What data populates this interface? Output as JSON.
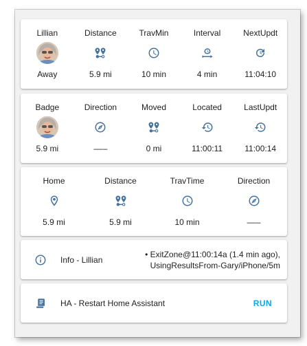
{
  "card1": {
    "columns": [
      {
        "header": "Lillian",
        "icon": "person-avatar",
        "value": "Away"
      },
      {
        "header": "Distance",
        "icon": "map-marker-distance-icon",
        "value": "5.9 mi"
      },
      {
        "header": "TravMin",
        "icon": "clock-outline-icon",
        "value": "10 min"
      },
      {
        "header": "Interval",
        "icon": "timer-sand-interval-icon",
        "value": "4 min"
      },
      {
        "header": "NextUpdt",
        "icon": "restart-clock-icon",
        "value": "11:04:10"
      }
    ]
  },
  "card2": {
    "columns": [
      {
        "header": "Badge",
        "icon": "person-avatar",
        "value": "5.9 mi"
      },
      {
        "header": "Direction",
        "icon": "compass-icon",
        "value": "–––"
      },
      {
        "header": "Moved",
        "icon": "map-marker-distance-icon",
        "value": "0 mi"
      },
      {
        "header": "Located",
        "icon": "history-clock-icon",
        "value": "11:00:11"
      },
      {
        "header": "LastUpdt",
        "icon": "history-clock-icon",
        "value": "11:00:14"
      }
    ]
  },
  "card3": {
    "columns": [
      {
        "header": "Home",
        "icon": "map-marker-outline-icon",
        "value": "5.9 mi"
      },
      {
        "header": "Distance",
        "icon": "map-marker-distance-icon",
        "value": "5.9 mi"
      },
      {
        "header": "TravTime",
        "icon": "clock-outline-icon",
        "value": "10 min"
      },
      {
        "header": "Direction",
        "icon": "compass-icon",
        "value": "–––"
      }
    ]
  },
  "info": {
    "icon": "information-outline-icon",
    "label": "Info - Lillian",
    "line1": "• ExitZone@11:00:14a (1.4 min ago),",
    "line2": "UsingResultsFrom-Gary/iPhone/5m"
  },
  "restart": {
    "icon": "script-text-icon",
    "label": "HA - Restart Home Assistant",
    "action": "RUN"
  },
  "colors": {
    "icon": "#44739e",
    "accent": "#03a9f4",
    "background": "#f1f1f1",
    "card": "#ffffff"
  }
}
